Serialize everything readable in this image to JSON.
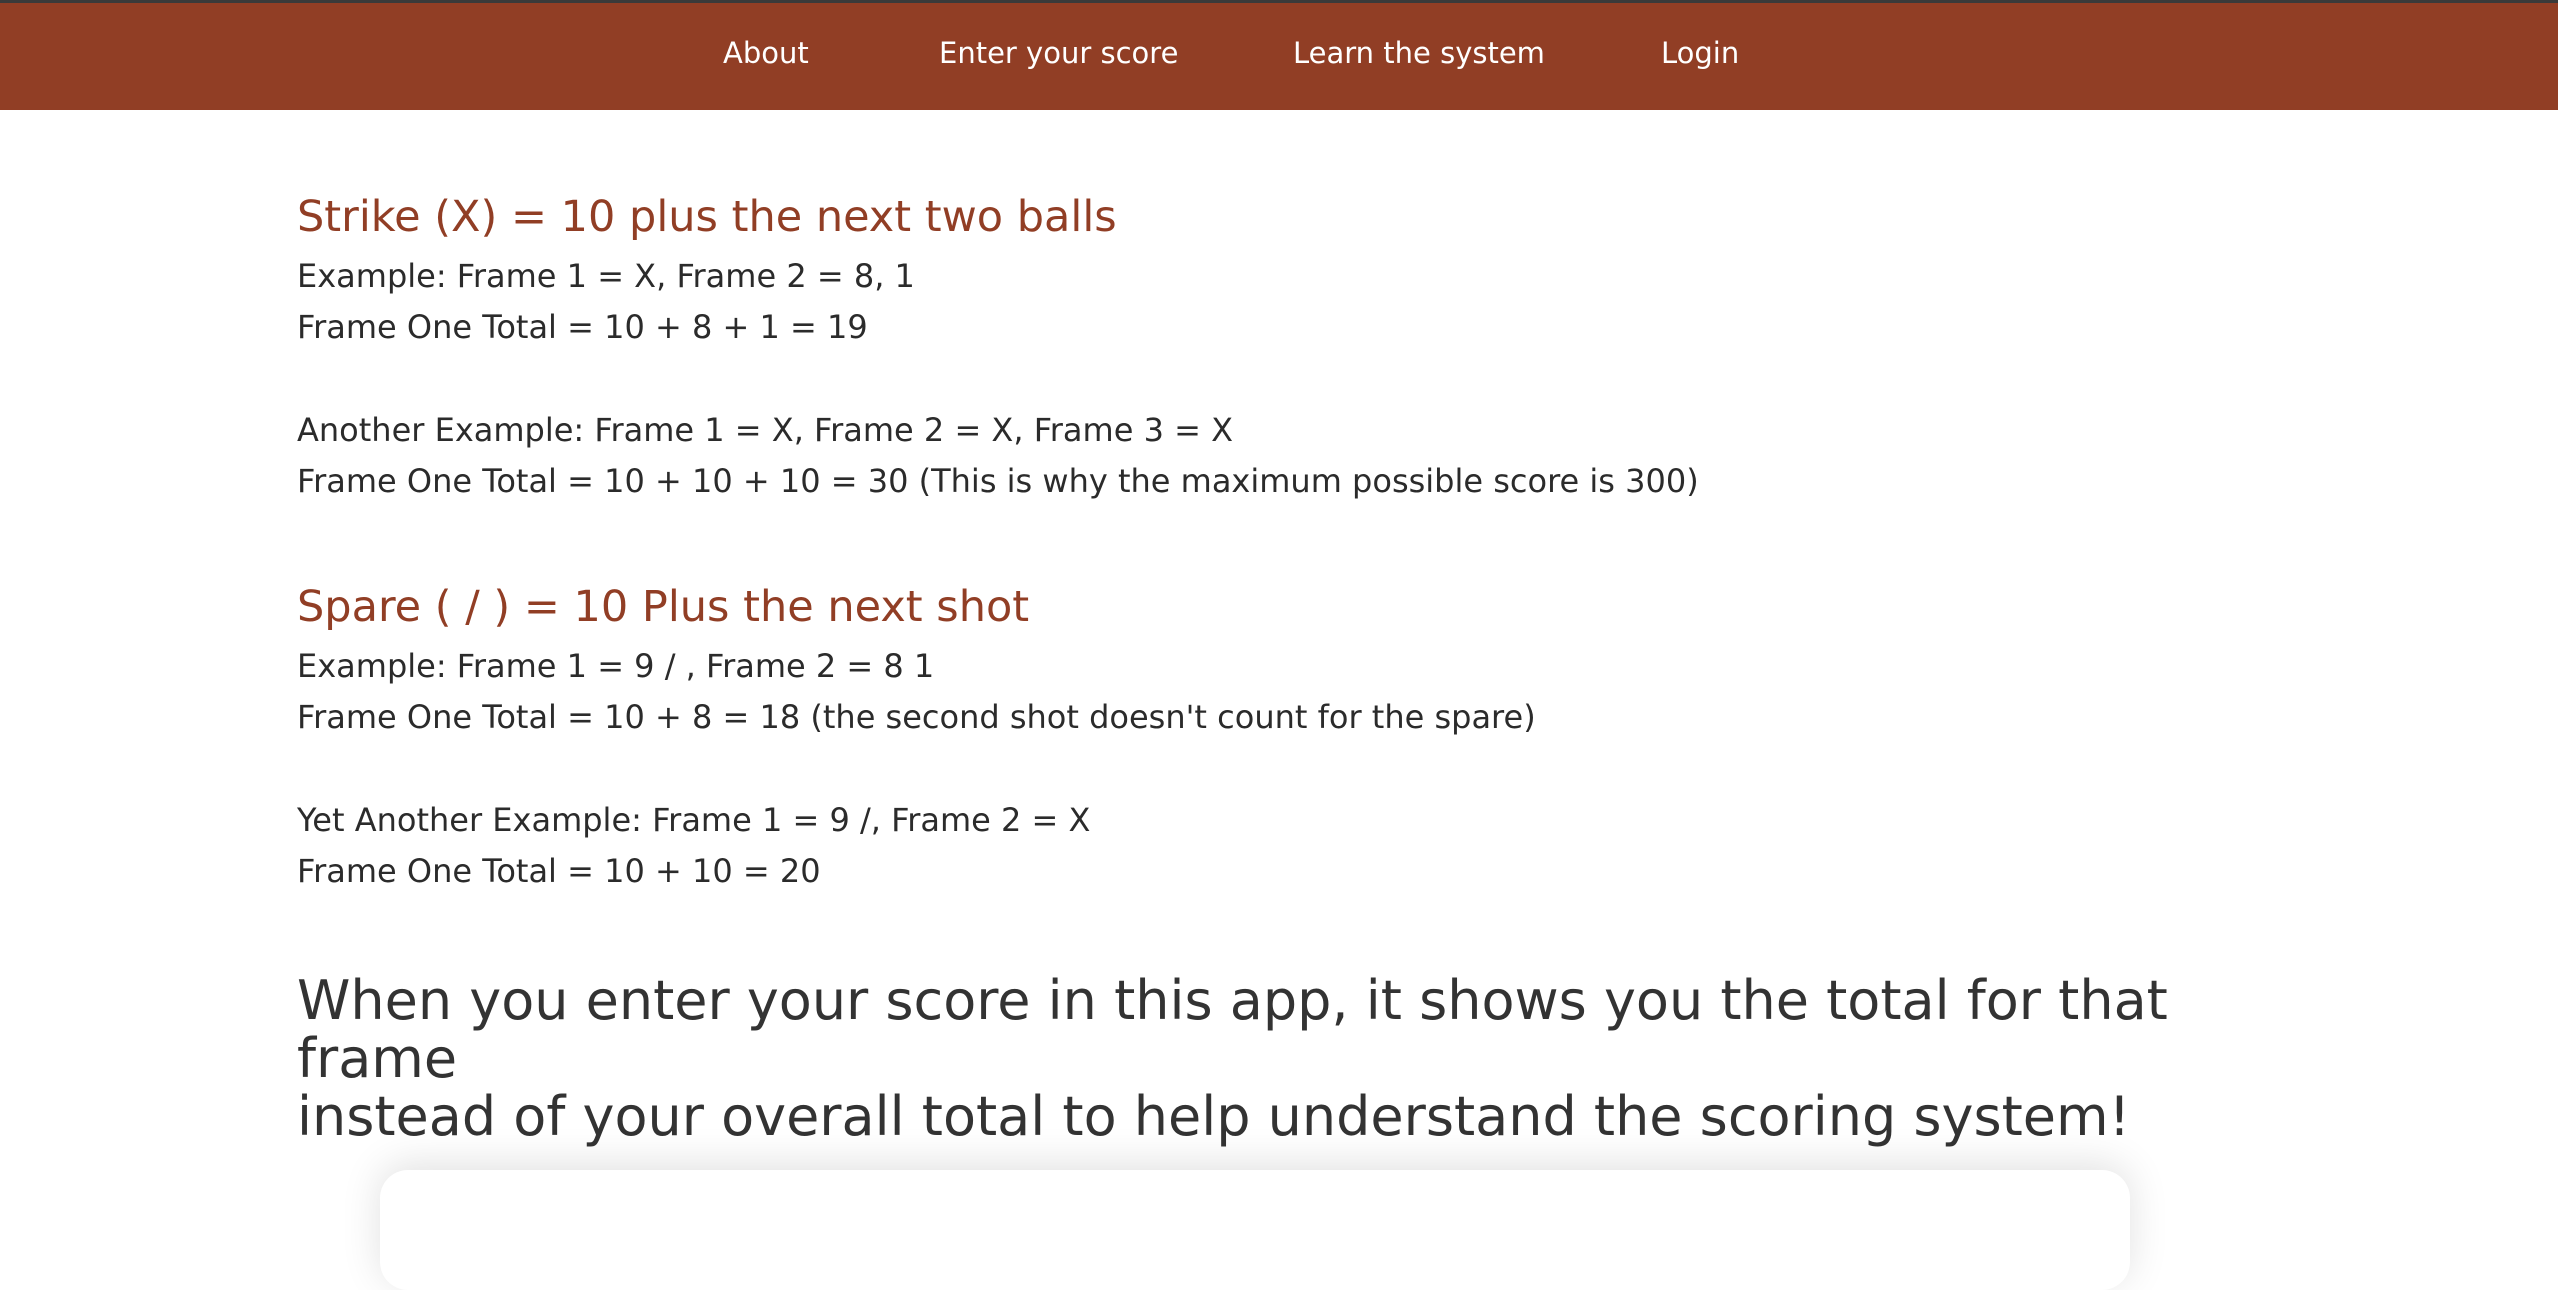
{
  "nav": {
    "items": [
      {
        "label": "About"
      },
      {
        "label": "Enter your score"
      },
      {
        "label": "Learn the system"
      },
      {
        "label": "Login"
      }
    ]
  },
  "strike": {
    "heading": "Strike (X) = 10 plus the next two balls",
    "ex1_line1": "Example: Frame 1 = X, Frame 2 = 8, 1",
    "ex1_line2": "Frame One Total = 10 + 8 + 1 = 19",
    "ex2_line1": "Another Example: Frame 1 = X, Frame 2 = X, Frame 3 = X",
    "ex2_line2": "Frame One Total = 10 + 10 + 10 = 30 (This is why the maximum possible score is 300)"
  },
  "spare": {
    "heading": "Spare ( / ) = 10 Plus the next shot",
    "ex1_line1": "Example: Frame 1 = 9 / , Frame 2 = 8 1",
    "ex1_line2": "Frame One Total = 10 + 8 = 18 (the second shot doesn't count for the spare)",
    "ex2_line1": "Yet Another Example: Frame 1 = 9 /, Frame 2 = X",
    "ex2_line2": "Frame One Total = 10 + 10 = 20"
  },
  "note": {
    "line1": "When you enter your score in this app, it shows you the total for that frame",
    "line2": "instead of your overall total to help understand the scoring system!"
  },
  "colors": {
    "brand": "#913e25",
    "text": "#2b2b2b"
  }
}
